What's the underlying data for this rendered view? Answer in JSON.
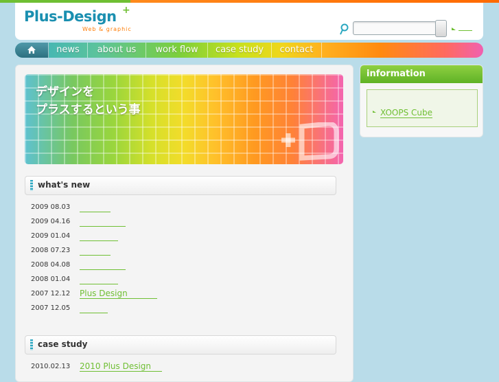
{
  "logo": {
    "name": "Plus-Design",
    "sub": "Web & graphic",
    "plus": "+"
  },
  "search": {
    "value": "",
    "placeholder": ""
  },
  "nav": {
    "items": [
      "news",
      "about us",
      "work flow",
      "case study",
      "contact"
    ]
  },
  "hero": {
    "line1": "デザインを",
    "line2": "プラスするという事",
    "mark": "+D"
  },
  "whats_new": {
    "title": "what's new",
    "items": [
      {
        "date": "2009 08.03",
        "text": ""
      },
      {
        "date": "2009 04.16",
        "text": ""
      },
      {
        "date": "2009 01.04",
        "text": ""
      },
      {
        "date": "2008 07.23",
        "text": ""
      },
      {
        "date": "2008 04.08",
        "text": ""
      },
      {
        "date": "2008 01.04",
        "text": ""
      },
      {
        "date": "2007 12.12",
        "text": "Plus Design"
      },
      {
        "date": "2007 12.05",
        "text": ""
      }
    ]
  },
  "case_study": {
    "title": "case study",
    "items": [
      {
        "date": "2010.02.13",
        "text": "2010 Plus Design"
      }
    ]
  },
  "information": {
    "title": "information",
    "link": "XOOPS Cube"
  },
  "colors": {
    "green": "#6fbf33",
    "orange": "#ff7a00",
    "teal": "#1a8fb0"
  }
}
